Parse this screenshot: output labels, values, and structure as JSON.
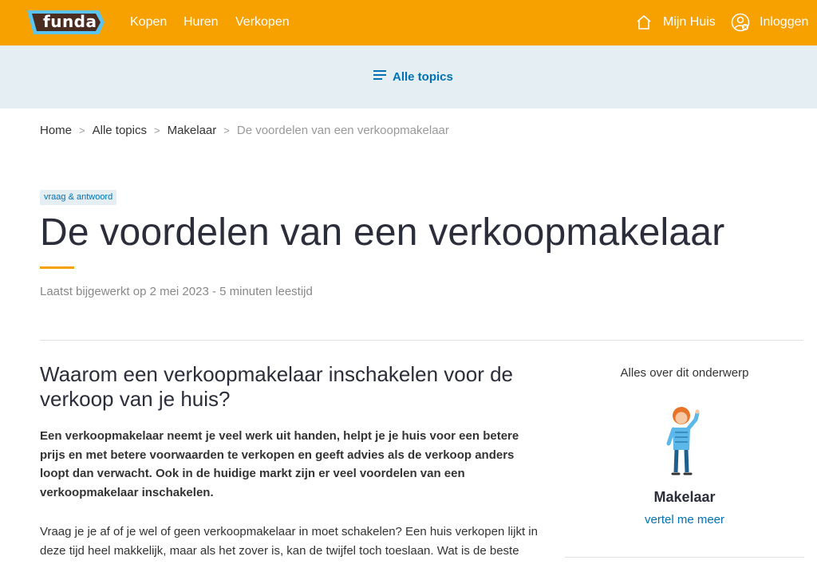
{
  "brand": {
    "logo_text": "funda",
    "primary_color": "#f7a100",
    "link_color": "#0071b3"
  },
  "nav": {
    "links": [
      "Kopen",
      "Huren",
      "Verkopen"
    ],
    "mijn_huis": "Mijn Huis",
    "login": "Inloggen"
  },
  "topics_button": "Alle topics",
  "breadcrumb": {
    "home": "Home",
    "alle_topics": "Alle topics",
    "makelaar": "Makelaar",
    "current": "De voordelen van een verkoopmakelaar",
    "separator": ">"
  },
  "article": {
    "tag": "vraag & antwoord",
    "title": "De voordelen van een verkoopmakelaar",
    "meta": "Laatst bijgewerkt op 2 mei 2023 - 5 minuten leestijd",
    "heading": "Waarom een verkoopmakelaar inschakelen voor de verkoop van je huis?",
    "intro": "Een verkoopmakelaar neemt je veel werk uit handen, helpt je je huis voor een betere prijs en met betere voorwaarden te verkopen en geeft advies als de verkoop anders loopt dan verwacht. Ook in de huidige markt zijn er veel voordelen van een verkoopmakelaar inschakelen.",
    "body": "Vraag je je af of je wel of geen verkoopmakelaar in moet schakelen? Een huis verkopen lijkt in deze tijd heel makkelijk, maar als het zover is, kan de twijfel toch toeslaan. Wat is de beste"
  },
  "sidebar": {
    "title": "Alles over dit onderwerp",
    "topic": "Makelaar",
    "link": "vertel me meer"
  },
  "icons": {
    "home": "house-icon",
    "user": "user-icon",
    "menu": "hamburger-icon",
    "illustration": "makelaar-person-illustration"
  }
}
